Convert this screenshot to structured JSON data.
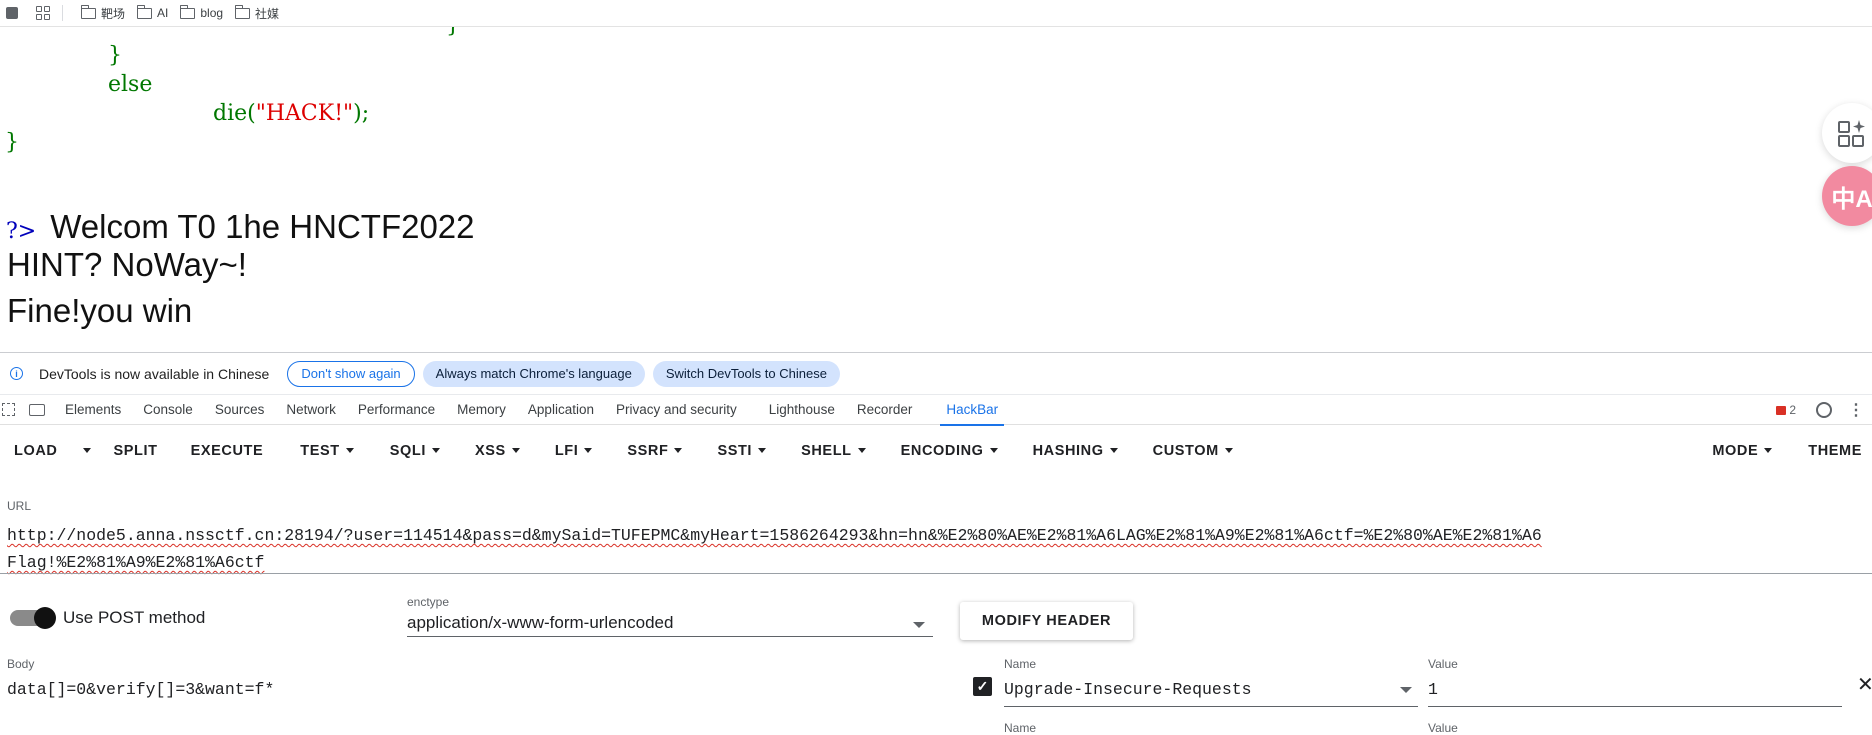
{
  "bookmarks": {
    "items": [
      {
        "label": "靶场"
      },
      {
        "label": "AI"
      },
      {
        "label": "blog"
      },
      {
        "label": "社媒"
      }
    ]
  },
  "page": {
    "code_lines": {
      "brace_top": "}",
      "brace_if": "}",
      "else_kw": "else",
      "die_fn": "die(",
      "die_str": "\"HACK!\"",
      "die_end": ");",
      "brace_close": "}"
    },
    "php_close": "?>",
    "output_lines": [
      "Welcom T0 1he HNCTF2022",
      "HINT? NoWay~!",
      "Fine!you win"
    ],
    "float_buttons": [
      {
        "icon": "apps-sparkle-icon"
      },
      {
        "icon": "translate-icon",
        "glyph": "中A"
      }
    ]
  },
  "devtools": {
    "infobar": {
      "message": "DevTools is now available in Chinese",
      "dont_show": "Don't show again",
      "always_match": "Always match Chrome's language",
      "switch": "Switch DevTools to Chinese"
    },
    "tabs": [
      "Elements",
      "Console",
      "Sources",
      "Network",
      "Performance",
      "Memory",
      "Application",
      "Privacy and security",
      "Lighthouse",
      "Recorder",
      "HackBar"
    ],
    "active_tab": "HackBar",
    "error_count": "2"
  },
  "hackbar": {
    "toolbar": {
      "load": "LOAD",
      "split": "SPLIT",
      "execute": "EXECUTE",
      "menus": [
        "TEST",
        "SQLI",
        "XSS",
        "LFI",
        "SSRF",
        "SSTI",
        "SHELL",
        "ENCODING",
        "HASHING",
        "CUSTOM"
      ],
      "mode": "MODE",
      "theme": "THEME"
    },
    "url_label": "URL",
    "url_value": "http://node5.anna.nssctf.cn:28194/?user=114514&pass=d&mySaid=TUFEPMC&myHeart=1586264293&hn=hn&%E2%80%AE%E2%81%A6LAG%E2%81%A9%E2%81%A6ctf=%E2%80%AE%E2%81%A6 Flag!%E2%81%A9%E2%81%A6ctf",
    "post_method_label": "Use POST method",
    "post_enabled": true,
    "enctype_label": "enctype",
    "enctype_value": "application/x-www-form-urlencoded",
    "modify_header": "MODIFY HEADER",
    "body_label": "Body",
    "body_value": "data[]=0&verify[]=3&want=f*",
    "header_row": {
      "checked": true,
      "name_label": "Name",
      "name_value": "Upgrade-Insecure-Requests",
      "value_label": "Value",
      "value_value": "1"
    },
    "next_row": {
      "name_label": "Name",
      "value_label": "Value"
    }
  },
  "colors": {
    "php_keyword": "#007700",
    "php_string": "#dd0000",
    "accent": "#1a73e8"
  }
}
